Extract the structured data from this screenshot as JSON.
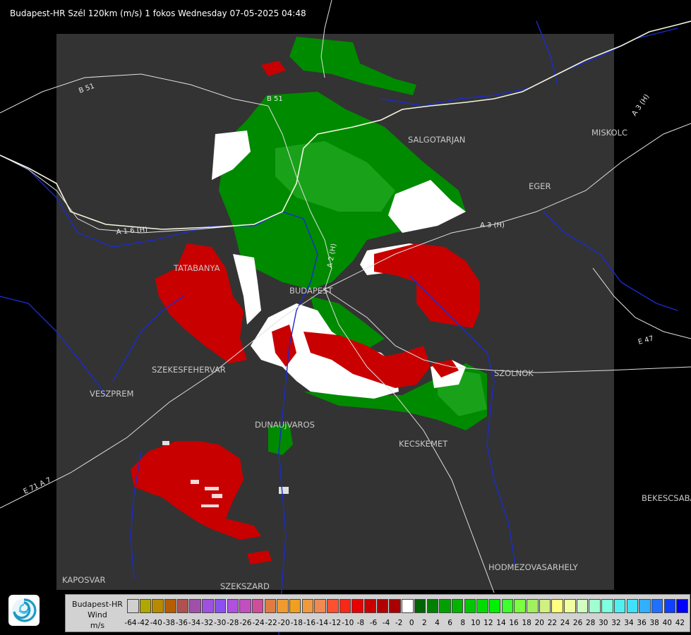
{
  "title": "Budapest-HR Szél 120km (m/s) 1 fokos Wednesday 07-05-2025 04:48",
  "cities": [
    {
      "name": "SALGOTARJAN"
    },
    {
      "name": "MISKOLC"
    },
    {
      "name": "EGER"
    },
    {
      "name": "TATABANYA"
    },
    {
      "name": "BUDAPEST"
    },
    {
      "name": "SZEKESFEHERVAR"
    },
    {
      "name": "VESZPREM"
    },
    {
      "name": "SZOLNOK"
    },
    {
      "name": "DUNAUJVAROS"
    },
    {
      "name": "KECSKEMET"
    },
    {
      "name": "BEKESCSABA"
    },
    {
      "name": "KAPOSVAR"
    },
    {
      "name": "SZEKSZARD"
    },
    {
      "name": "HODMEZOVASARHELY"
    }
  ],
  "roads": [
    "B 51",
    "B 51",
    "A 3 (H)",
    "A 3 (H)",
    "A 1 6 (H)",
    "A 2 (H)",
    "E 47",
    "E 71 A 7"
  ],
  "legend": {
    "line1": "Budapest-HR",
    "line2": "Wind",
    "line3": "m/s",
    "colors": [
      "#d0d0d0",
      "#b0a800",
      "#b88a00",
      "#b85c00",
      "#b05050",
      "#a050a8",
      "#a050e0",
      "#8c50f0",
      "#b050e0",
      "#c050c0",
      "#d04c9c",
      "#e07c40",
      "#f09a30",
      "#f0a020",
      "#f09a40",
      "#f08a50",
      "#ff5030",
      "#f82818",
      "#e80000",
      "#c80000",
      "#b00000",
      "#a80000",
      "#ffffff",
      "#006400",
      "#008000",
      "#00a000",
      "#00b400",
      "#00c800",
      "#00dc00",
      "#00f000",
      "#40ff30",
      "#7cff40",
      "#a0f060",
      "#d0f080",
      "#ffff80",
      "#f0ffa0",
      "#d0ffc0",
      "#a0ffd0",
      "#80ffe0",
      "#50f0f0",
      "#40e0ff",
      "#30b0ff",
      "#2070ff",
      "#1040ff",
      "#0000ff"
    ],
    "ticks": [
      "-64",
      "-42",
      "-40",
      "-38",
      "-36",
      "-34",
      "-32",
      "-30",
      "-28",
      "-26",
      "-24",
      "-22",
      "-20",
      "-18",
      "-16",
      "-14",
      "-12",
      "-10",
      "-8",
      "-6",
      "-4",
      "-2",
      "0",
      "2",
      "4",
      "6",
      "8",
      "10",
      "12",
      "14",
      "16",
      "18",
      "20",
      "22",
      "24",
      "26",
      "28",
      "30",
      "32",
      "34",
      "36",
      "38",
      "40",
      "42"
    ]
  },
  "logo_icon": "omsz-swirl-icon"
}
